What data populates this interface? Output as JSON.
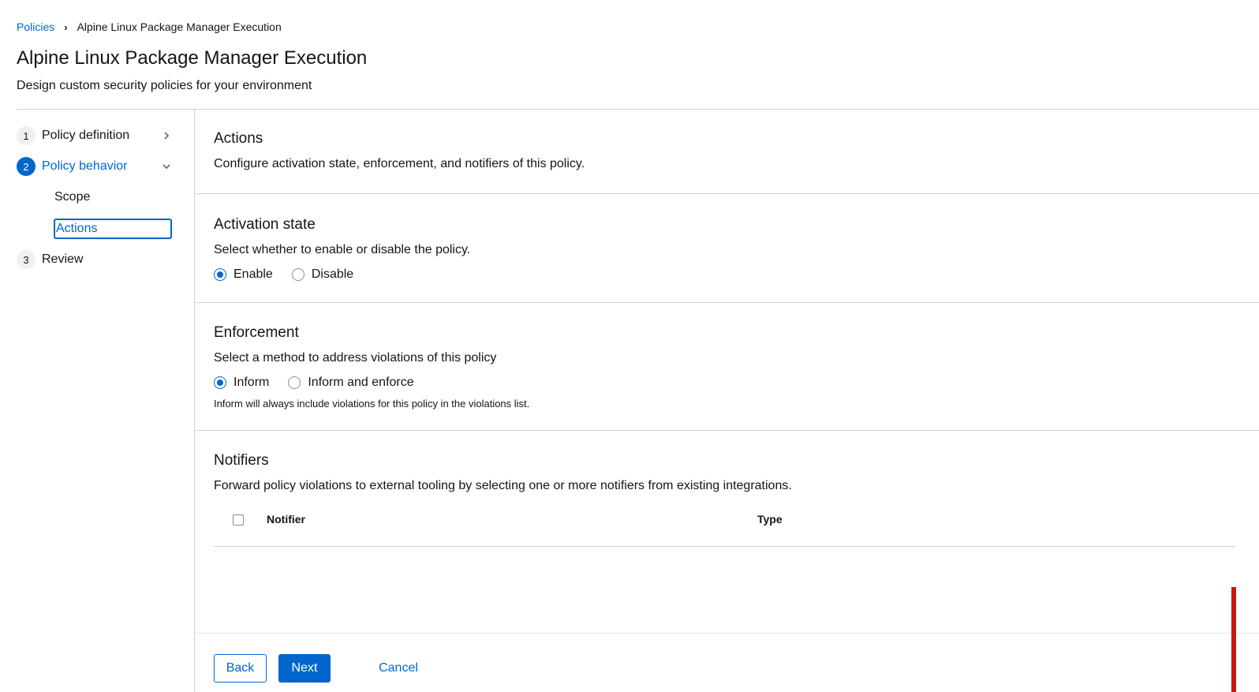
{
  "breadcrumb": {
    "root": "Policies",
    "separator": "›",
    "current": "Alpine Linux Package Manager Execution"
  },
  "header": {
    "title": "Alpine Linux Package Manager Execution",
    "subtitle": "Design custom security policies for your environment"
  },
  "wizard_nav": {
    "steps": [
      {
        "number": "1",
        "label": "Policy definition",
        "icon": "chevron-right-icon"
      },
      {
        "number": "2",
        "label": "Policy behavior",
        "icon": "chevron-down-icon",
        "active": true,
        "substeps": [
          {
            "label": "Scope"
          },
          {
            "label": "Actions",
            "current": true
          }
        ]
      },
      {
        "number": "3",
        "label": "Review"
      }
    ]
  },
  "actions": {
    "title": "Actions",
    "description": "Configure activation state, enforcement, and notifiers of this policy."
  },
  "activation": {
    "title": "Activation state",
    "description": "Select whether to enable or disable the policy.",
    "options": [
      {
        "label": "Enable",
        "checked": true
      },
      {
        "label": "Disable",
        "checked": false
      }
    ]
  },
  "enforcement": {
    "title": "Enforcement",
    "description": "Select a method to address violations of this policy",
    "options": [
      {
        "label": "Inform",
        "checked": true
      },
      {
        "label": "Inform and enforce",
        "checked": false
      }
    ],
    "helper": "Inform will always include violations for this policy in the violations list."
  },
  "notifiers": {
    "title": "Notifiers",
    "description": "Forward policy violations to external tooling by selecting one or more notifiers from existing integrations.",
    "columns": [
      "Notifier",
      "Type"
    ],
    "rows": []
  },
  "footer": {
    "back": "Back",
    "next": "Next",
    "cancel": "Cancel"
  },
  "colors": {
    "accent": "#0066cc",
    "text": "#151515",
    "border": "#d2d2d2",
    "scroll_marker": "#c9190b"
  }
}
